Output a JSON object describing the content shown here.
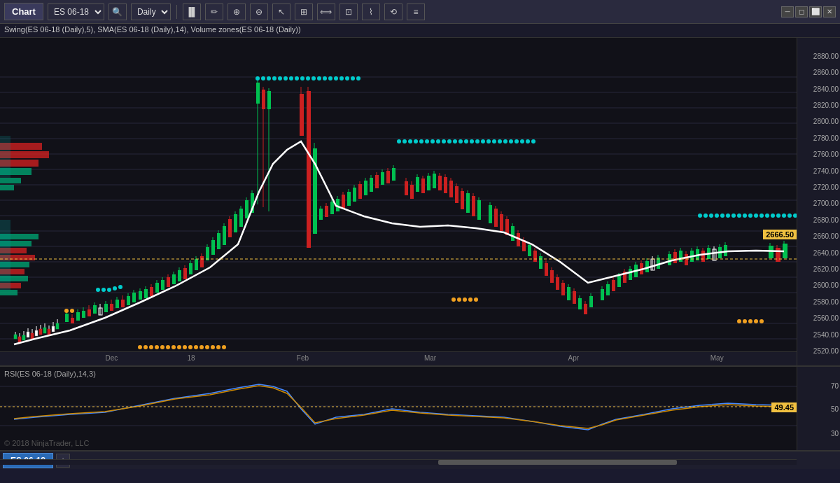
{
  "titleBar": {
    "title": "Chart",
    "instrument": "ES 06-18",
    "period": "Daily",
    "toolbar": {
      "search": "🔍",
      "draw": "✏",
      "zoomIn": "+",
      "zoomOut": "−",
      "cursor": "↖",
      "other1": "⊞",
      "other2": "⟺",
      "other3": "⊡",
      "other4": "⌇",
      "other5": "⟲",
      "other6": "≡"
    }
  },
  "indicatorLabel": "Swing(ES 06-18 (Daily),5), SMA(ES 06-18 (Daily),14), Volume zones(ES 06-18 (Daily))",
  "priceAxis": {
    "labels": [
      2520,
      2540,
      2560,
      2580,
      2600,
      2620,
      2640,
      2660,
      2680,
      2700,
      2720,
      2740,
      2760,
      2780,
      2800,
      2820,
      2840,
      2860,
      2880
    ],
    "currentPrice": "2666.50",
    "min": 2510,
    "max": 2890
  },
  "rsiAxis": {
    "labels": [
      30,
      50,
      70
    ],
    "currentValue": "49.45",
    "indicatorLabel": "RSI(ES 06-18 (Daily),14,3)"
  },
  "timeAxis": {
    "labels": [
      "Dec",
      "18",
      "Feb",
      "Mar",
      "Apr",
      "May"
    ]
  },
  "watermark": "© 2018 NinjaTrader, LLC",
  "bottomTab": {
    "instrument": "ES 06-18",
    "addLabel": "+"
  },
  "colors": {
    "background": "#111118",
    "gridLine": "rgba(80,80,120,0.35)",
    "bullCandle": "#00c050",
    "bearCandle": "#cc2020",
    "smaLine": "#ffffff",
    "swingHighDots": "#00cccc",
    "swingLowDots": "#f0a020",
    "rsiLine": "#4488ff",
    "rsiSignalLine": "#cc8800",
    "volumeZoneBull": "#00a070",
    "volumeZoneBear": "#cc2020",
    "currentPriceBg": "#f0c040",
    "rsiBadgeBg": "#f0c040"
  }
}
